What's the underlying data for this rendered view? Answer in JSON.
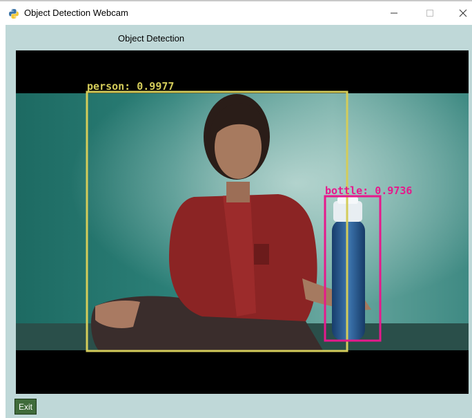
{
  "window": {
    "title": "Object Detection Webcam"
  },
  "header": {
    "label": "Object Detection"
  },
  "detections": [
    {
      "label": "person: 0.9977",
      "color": "#d4cc5a"
    },
    {
      "label": "bottle: 0.9736",
      "color": "#e6198c"
    }
  ],
  "footer": {
    "exit_label": "Exit"
  },
  "colors": {
    "client_background": "#bfd8d8",
    "video_background": "#000000",
    "exit_button": "#3f6b3a"
  }
}
